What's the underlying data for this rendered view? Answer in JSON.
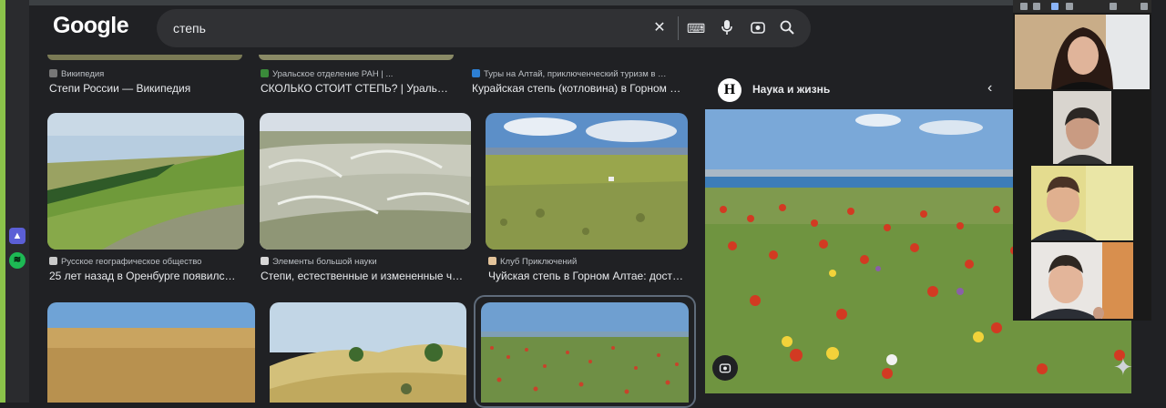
{
  "search": {
    "query": "степь"
  },
  "logo": "Google",
  "results": [
    {
      "source": "Википедия",
      "title": "Степи России — Википедия",
      "fav": "#4a4a4a"
    },
    {
      "source": "Уральское отделение РАН | ...",
      "title": "СКОЛЬКО СТОИТ СТЕПЬ? | Ураль…",
      "fav": "#3a8a3a"
    },
    {
      "source": "Туры на Алтай, приключенческий туризм в …",
      "title": "Курайская степь (котловина) в Горном …",
      "fav": "#2d7fd3"
    },
    {
      "source": "Русское географическое общество",
      "title": "25 лет назад в Оренбурге появилс…",
      "fav": "#c9c9c9"
    },
    {
      "source": "Элементы большой науки",
      "title": "Степи, естественные и измененные ч…",
      "fav": "#d7d7d7"
    },
    {
      "source": "Клуб Приключений",
      "title": "Чуйская степь в Горном Алтае: дост…",
      "fav": "#e3c39a"
    }
  ],
  "panel": {
    "source_initial": "Н",
    "source_name": "Наука и жизнь"
  },
  "icons": {
    "clear": "close-icon",
    "keyboard": "keyboard-icon",
    "voice": "mic-icon",
    "lens": "camera-search-icon",
    "search": "search-icon",
    "back": "chevron-left-icon",
    "assistant": "sparkle-icon"
  }
}
